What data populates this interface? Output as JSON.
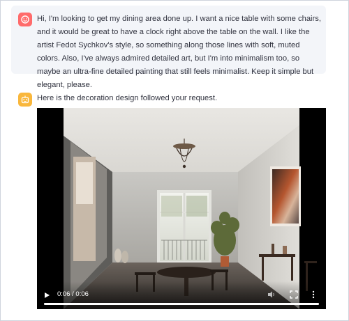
{
  "user_message": {
    "avatar_icon": "smiley-face-icon",
    "avatar_color": "#ff6b6b",
    "text": "Hi, I'm looking to get my dining area done up. I want a nice table with some chairs, and it would be great to have a clock right above the table on the wall. I like the artist Fedot Sychkov's style, so something along those lines with soft, muted colors. Also, I've always admired detailed art, but I'm into minimalism too, so maybe an ultra-fine detailed painting that still feels minimalist. Keep it simple but elegant, please."
  },
  "assistant_message": {
    "avatar_icon": "robot-icon",
    "avatar_color": "#f9b73c",
    "text": "Here is the decoration design followed your request."
  },
  "video_player": {
    "time_display": "0:06 / 0:06",
    "progress": 1.0,
    "icons": {
      "play": "play-icon",
      "volume": "volume-icon",
      "fullscreen": "fullscreen-icon",
      "more": "more-options-icon"
    }
  }
}
